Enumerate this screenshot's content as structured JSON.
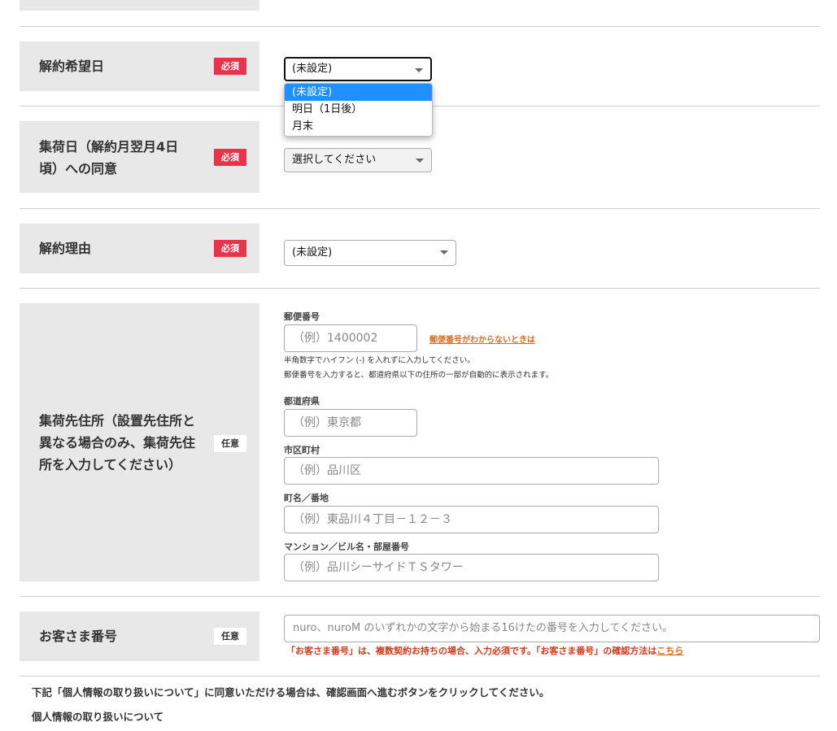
{
  "cancel_date": {
    "label": "解約希望日",
    "badge": "必須",
    "select_value": "(未設定)",
    "options": [
      "(未設定)",
      "明日（1日後）",
      "月末"
    ]
  },
  "pickup_consent": {
    "label_line1": "集荷日（解約月翌月4日",
    "label_line2": "頃）への同意",
    "badge": "必須",
    "select_value": "選択してください"
  },
  "cancel_reason": {
    "label": "解約理由",
    "badge": "必須",
    "select_value": "(未設定)"
  },
  "pickup_address": {
    "label_line1": "集荷先住所（設置先住所と",
    "label_line2": "異なる場合のみ、集荷先住",
    "label_line3": "所を入力してください）",
    "badge": "任意",
    "postal": {
      "label": "郵便番号",
      "placeholder": "（例）1400002",
      "help_link": "郵便番号がわからないときは",
      "note1": "半角数字でハイフン (-) を入れずに入力してください。",
      "note2": "郵便番号を入力すると、都道府県以下の住所の一部が自動的に表示されます。"
    },
    "prefecture": {
      "label": "都道府県",
      "placeholder": "（例）東京都"
    },
    "city": {
      "label": "市区町村",
      "placeholder": "（例）品川区"
    },
    "street": {
      "label": "町名／番地",
      "placeholder": "（例）東品川４丁目－１２－３"
    },
    "building": {
      "label": "マンション／ビル名・部屋番号",
      "placeholder": "（例）品川シーサイドＴＳタワー"
    }
  },
  "customer_number": {
    "label": "お客さま番号",
    "badge": "任意",
    "placeholder": "nuro、nuroM のいずれかの文字から始まる16けたの番号を入力してください。",
    "note": "「お客さま番号」は、複数契約お持ちの場合、入力必須です。「お客さま番号」の確認方法は",
    "note_link": "こちら"
  },
  "footer": {
    "consent_text": "下記「個人情報の取り扱いについて」に同意いただける場合は、確認画面へ進むボタンをクリックしてください。",
    "privacy_heading": "個人情報の取り扱いについて"
  },
  "colors": {
    "required_badge": "#e8334a",
    "label_bg": "#e8e8e8",
    "dropdown_highlight": "#1e90ff",
    "link": "#e06a1a",
    "note_red": "#d23a1a"
  }
}
